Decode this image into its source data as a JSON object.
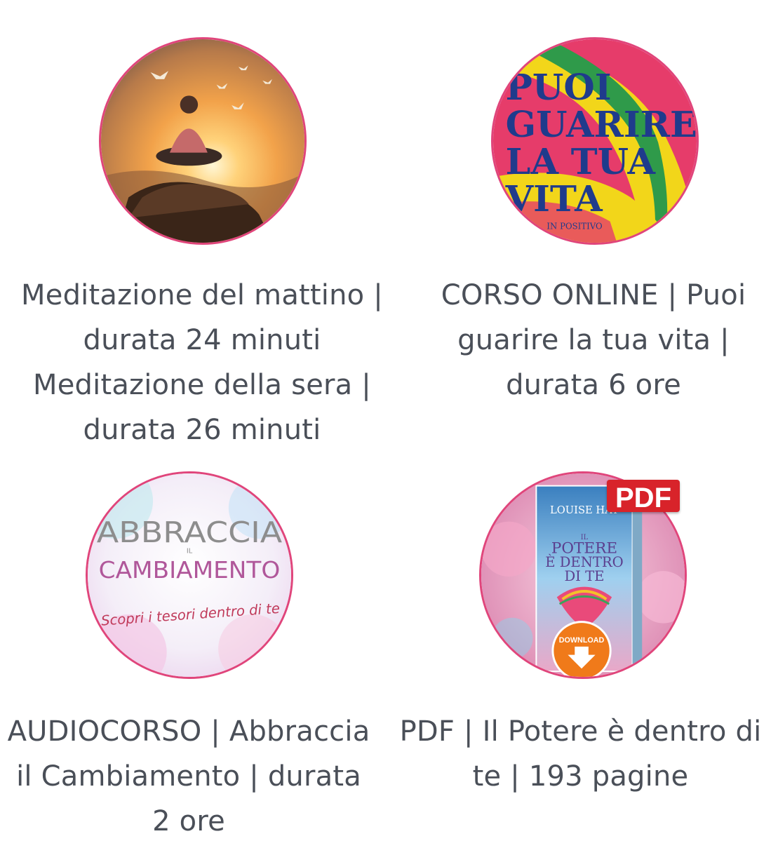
{
  "products": [
    {
      "image_label": "meditation-sunset-photo",
      "caption_lines": [
        "Meditazione del mattino |",
        "durata 24 minuti",
        "Meditazione della sera |",
        "durata 26 minuti"
      ]
    },
    {
      "image_label": "puoi-guarire-la-tua-vita-cover",
      "cover_text": [
        "PUOI",
        "GUARIRE",
        "LA TUA",
        "VITA",
        "IN POSITIVO"
      ],
      "caption_lines": [
        "CORSO ONLINE | Puoi",
        "guarire la tua vita |",
        "durata 6 ore"
      ]
    },
    {
      "image_label": "abbraccia-il-cambiamento-cover",
      "cover_text": [
        "ABBRACCIA",
        "IL",
        "CAMBIAMENTO",
        "Scopri i tesori dentro di te"
      ],
      "caption_lines": [
        "AUDIOCORSO | Abbraccia",
        "il Cambiamento | durata",
        "2 ore"
      ]
    },
    {
      "image_label": "il-potere-e-dentro-di-te-book",
      "cover_text": [
        "LOUISE HAY",
        "IL",
        "POTERE",
        "È DENTRO",
        "DI TE",
        "DOWNLOAD"
      ],
      "badge": "PDF",
      "caption_lines": [
        "PDF | Il Potere è dentro di",
        "te | 193 pagine"
      ]
    }
  ],
  "colors": {
    "ring": "#e0457b",
    "caption_text": "#4a4f58",
    "pdf_badge": "#d8232a",
    "download_button": "#f07a1a"
  }
}
